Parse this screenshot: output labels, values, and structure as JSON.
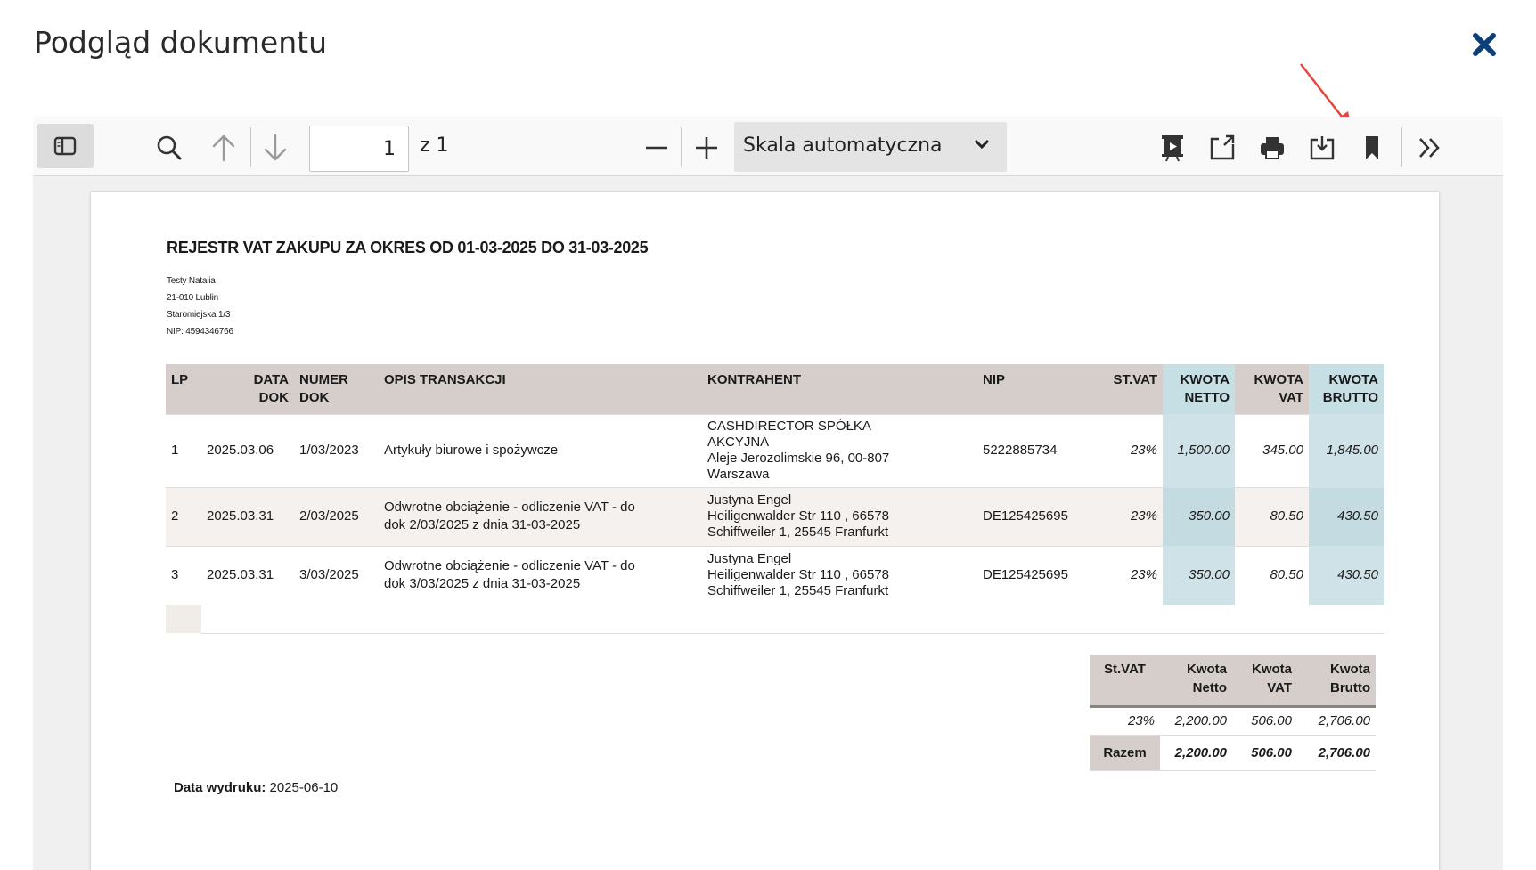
{
  "dialog": {
    "title": "Podgląd dokumentu"
  },
  "toolbar": {
    "page_number": "1",
    "page_total": "z 1",
    "scale_label": "Skala automatyczna"
  },
  "document": {
    "title": "REJESTR VAT ZAKUPU ZA OKRES OD 01-03-2025 DO 31-03-2025",
    "company": {
      "name": "Testy Natalia",
      "city": "21-010 Lublin",
      "street": "Staromiejska 1/3",
      "nip": "NIP: 4594346766"
    },
    "table": {
      "headers": {
        "lp": "LP",
        "data_dok_1": "DATA",
        "data_dok_2": "DOK",
        "numer_dok_1": "NUMER",
        "numer_dok_2": "DOK",
        "opis": "OPIS TRANSAKCJI",
        "kontrahent": "KONTRAHENT",
        "nip": "NIP",
        "st_vat": "ST.VAT",
        "netto_1": "KWOTA",
        "netto_2": "NETTO",
        "vat_1": "KWOTA",
        "vat_2": "VAT",
        "brutto_1": "KWOTA",
        "brutto_2": "BRUTTO"
      },
      "rows": [
        {
          "lp": "1",
          "date": "2025.03.06",
          "number": "1/03/2023",
          "description": "Artykuły biurowe i spożywcze",
          "contractor_1": "CASHDIRECTOR SPÓŁKA",
          "contractor_2": "AKCYJNA",
          "contractor_3": "Aleje Jerozolimskie 96, 00-807",
          "contractor_4": "Warszawa",
          "nip": "5222885734",
          "vat_rate": "23%",
          "net": "1,500.00",
          "vat": "345.00",
          "gross": "1,845.00"
        },
        {
          "lp": "2",
          "date": "2025.03.31",
          "number": "2/03/2025",
          "description_1": "Odwrotne obciążenie - odliczenie VAT - do",
          "description_2": "dok 2/03/2025 z dnia 31-03-2025",
          "contractor_1": "Justyna Engel",
          "contractor_2": "Heiligenwalder Str 110 , 66578",
          "contractor_3": "Schiffweiler 1, 25545 Franfurkt",
          "nip": "DE125425695",
          "vat_rate": "23%",
          "net": "350.00",
          "vat": "80.50",
          "gross": "430.50"
        },
        {
          "lp": "3",
          "date": "2025.03.31",
          "number": "3/03/2025",
          "description_1": "Odwrotne obciążenie - odliczenie VAT - do",
          "description_2": "dok 3/03/2025 z dnia 31-03-2025",
          "contractor_1": "Justyna Engel",
          "contractor_2": "Heiligenwalder Str 110 , 66578",
          "contractor_3": "Schiffweiler 1, 25545 Franfurkt",
          "nip": "DE125425695",
          "vat_rate": "23%",
          "net": "350.00",
          "vat": "80.50",
          "gross": "430.50"
        }
      ]
    },
    "summary": {
      "headers": {
        "st_vat": "St.VAT",
        "netto_1": "Kwota",
        "netto_2": "Netto",
        "vat_1": "Kwota",
        "vat_2": "VAT",
        "brutto_1": "Kwota",
        "brutto_2": "Brutto"
      },
      "row": {
        "rate": "23%",
        "net": "2,200.00",
        "vat": "506.00",
        "gross": "2,706.00"
      },
      "total": {
        "label": "Razem",
        "net": "2,200.00",
        "vat": "506.00",
        "gross": "2,706.00"
      }
    },
    "print_date": {
      "label": "Data wydruku:",
      "value": "2025-06-10"
    }
  },
  "colors": {
    "header_bg": "#d5ceca",
    "amount_highlight": "#c6dfe4",
    "annotation_arrow": "#e8453c"
  },
  "icons": [
    "close-icon",
    "sidebar-toggle-icon",
    "search-icon",
    "arrow-up-icon",
    "arrow-down-icon",
    "zoom-out-icon",
    "zoom-in-icon",
    "chevron-down-icon",
    "presentation-icon",
    "open-file-icon",
    "print-icon",
    "download-icon",
    "bookmark-icon",
    "more-tools-icon"
  ]
}
